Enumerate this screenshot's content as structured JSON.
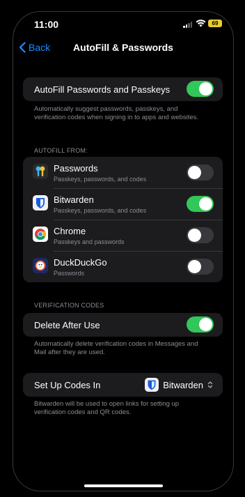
{
  "status": {
    "time": "11:00",
    "battery": "69"
  },
  "nav": {
    "back_label": "Back",
    "title": "AutoFill & Passwords"
  },
  "autofill_toggle": {
    "label": "AutoFill Passwords and Passkeys",
    "on": true,
    "caption": "Automatically suggest passwords, passkeys, and verification codes when signing in to apps and websites."
  },
  "autofill_from": {
    "header": "AUTOFILL FROM:",
    "apps": [
      {
        "name": "Passwords",
        "subtitle": "Passkeys, passwords, and codes",
        "on": false,
        "icon": "key-icon"
      },
      {
        "name": "Bitwarden",
        "subtitle": "Passkeys, passwords, and codes",
        "on": true,
        "icon": "bitwarden-shield-icon"
      },
      {
        "name": "Chrome",
        "subtitle": "Passkeys and passwords",
        "on": false,
        "icon": "chrome-icon"
      },
      {
        "name": "DuckDuckGo",
        "subtitle": "Passwords",
        "on": false,
        "icon": "duckduckgo-icon"
      }
    ]
  },
  "verification": {
    "header": "VERIFICATION CODES",
    "delete_label": "Delete After Use",
    "delete_on": true,
    "delete_caption": "Automatically delete verification codes in Messages and Mail after they are used."
  },
  "setup_codes": {
    "label": "Set Up Codes In",
    "value": "Bitwarden",
    "caption": "Bitwarden will be used to open links for setting up verification codes and QR codes."
  },
  "colors": {
    "accent": "#1e8bff",
    "toggle_on": "#32c759",
    "toggle_off": "#39393d",
    "group_bg": "#1c1c1e"
  }
}
